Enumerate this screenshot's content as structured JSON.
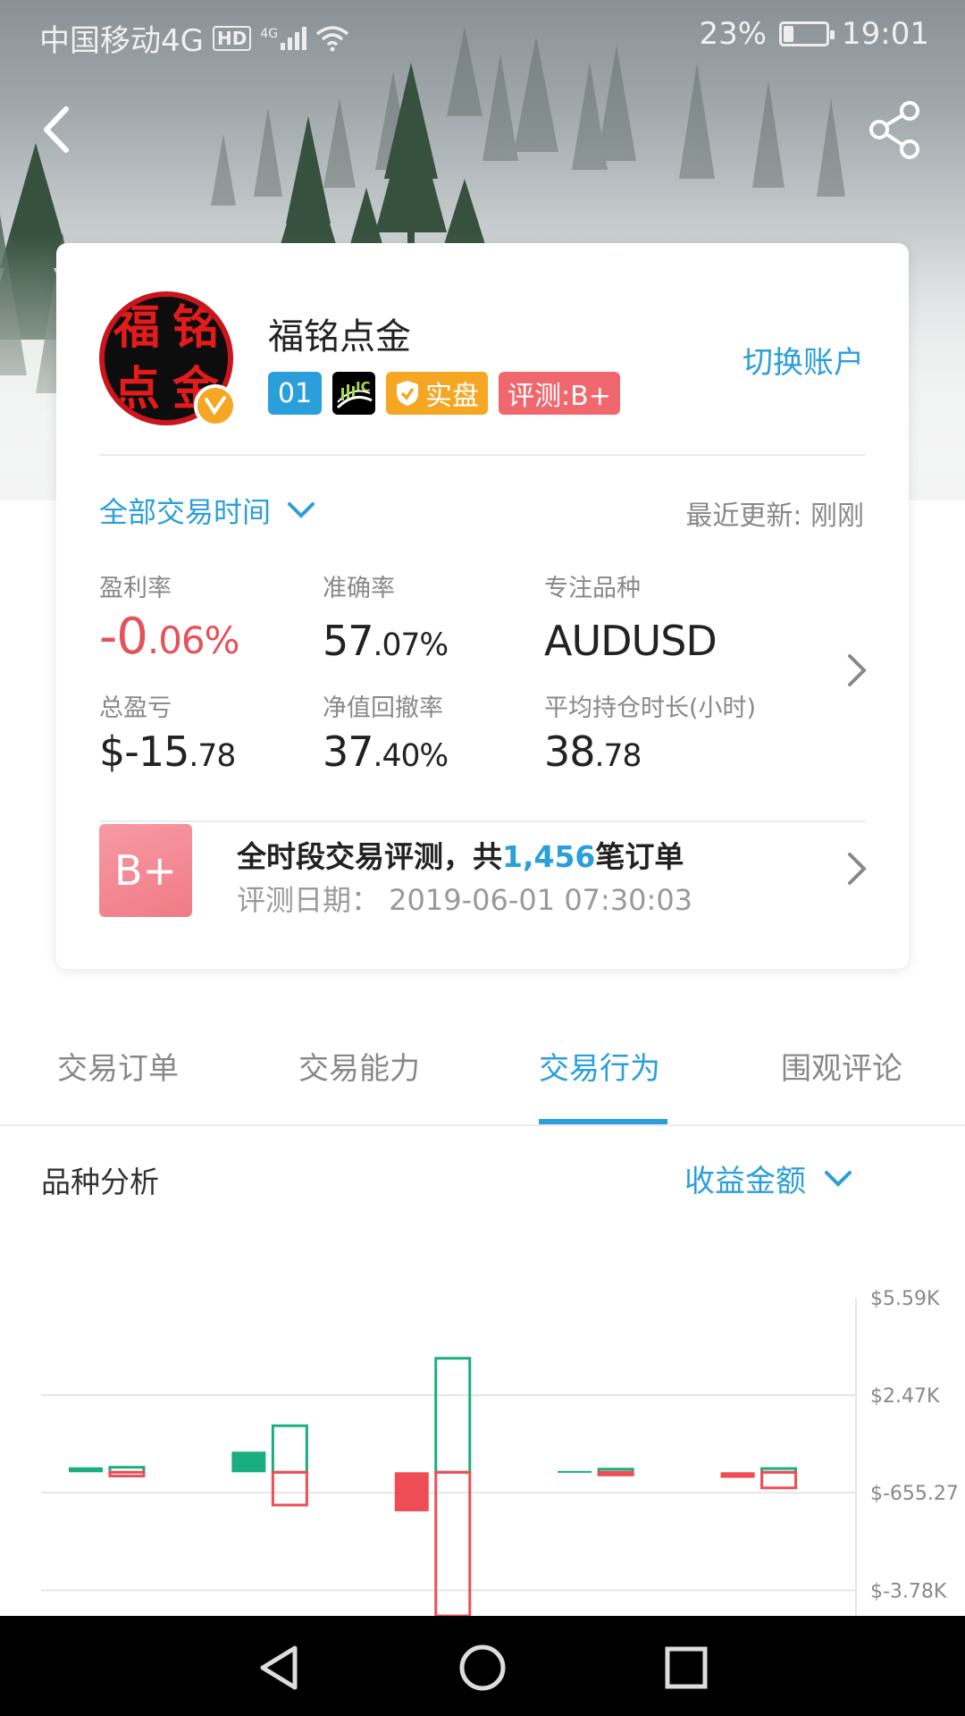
{
  "status_bar": {
    "carrier": "中国移动4G",
    "hd": "HD",
    "network": "4G",
    "battery": "23%",
    "battery_level": 0.23,
    "time": "19:01"
  },
  "header": {
    "back_icon": "chevron-left-icon",
    "share_icon": "share-icon"
  },
  "profile": {
    "avatar_chars": [
      "福",
      "铭",
      "点",
      "金"
    ],
    "name": "福铭点金",
    "badges": {
      "number": "01",
      "ic": "IC",
      "real": "实盘",
      "rating": "评测:B+"
    },
    "switch_account": "切换账户"
  },
  "filters": {
    "period": "全部交易时间",
    "updated": "最近更新: 刚刚"
  },
  "stats": [
    {
      "label": "盈利率",
      "main": "-0",
      "small": ".06%",
      "color": "#e5525a"
    },
    {
      "label": "准确率",
      "main": "57",
      "small": ".07%"
    },
    {
      "label": "专注品种",
      "main": "AUDUSD",
      "small": ""
    },
    {
      "label": "总盈亏",
      "main": "$-15",
      "small": ".78"
    },
    {
      "label": "净值回撤率",
      "main": "37",
      "small": ".40%"
    },
    {
      "label": "平均持仓时长(小时)",
      "main": "38",
      "small": ".78"
    }
  ],
  "evaluation": {
    "grade": "B+",
    "title_prefix": "全时段交易评测，共",
    "order_count": "1,456",
    "title_suffix": "笔订单",
    "date": "评测日期：  2019-06-01 07:30:03"
  },
  "tabs": [
    {
      "label": "交易订单",
      "active": false
    },
    {
      "label": "交易能力",
      "active": false
    },
    {
      "label": "交易行为",
      "active": true
    },
    {
      "label": "围观评论",
      "active": false
    }
  ],
  "analysis": {
    "title": "品种分析",
    "metric": "收益金额"
  },
  "chart_data": {
    "type": "bar",
    "y_ticks": [
      "$5.59K",
      "$2.47K",
      "$-655.27",
      "$-3.78K"
    ],
    "y_tick_values": [
      5590,
      2470,
      -655.27,
      -3780
    ],
    "ylim": [
      -4600,
      5590
    ],
    "colors": {
      "profit": "#1aad7f",
      "loss": "#ef4d55"
    },
    "groups": [
      {
        "net": 160,
        "gross_profit": 160,
        "gross_loss": -120
      },
      {
        "net": 660,
        "gross_profit": 1490,
        "gross_loss": -1050
      },
      {
        "net": -1250,
        "gross_profit": 3650,
        "gross_loss": -4600
      },
      {
        "net": 40,
        "gross_profit": 100,
        "gross_loss": -80
      },
      {
        "net": -180,
        "gross_profit": 120,
        "gross_loss": -500
      }
    ]
  },
  "nav_bar": {
    "back": "triangle-back-icon",
    "home": "circle-home-icon",
    "recents": "square-recents-icon"
  }
}
